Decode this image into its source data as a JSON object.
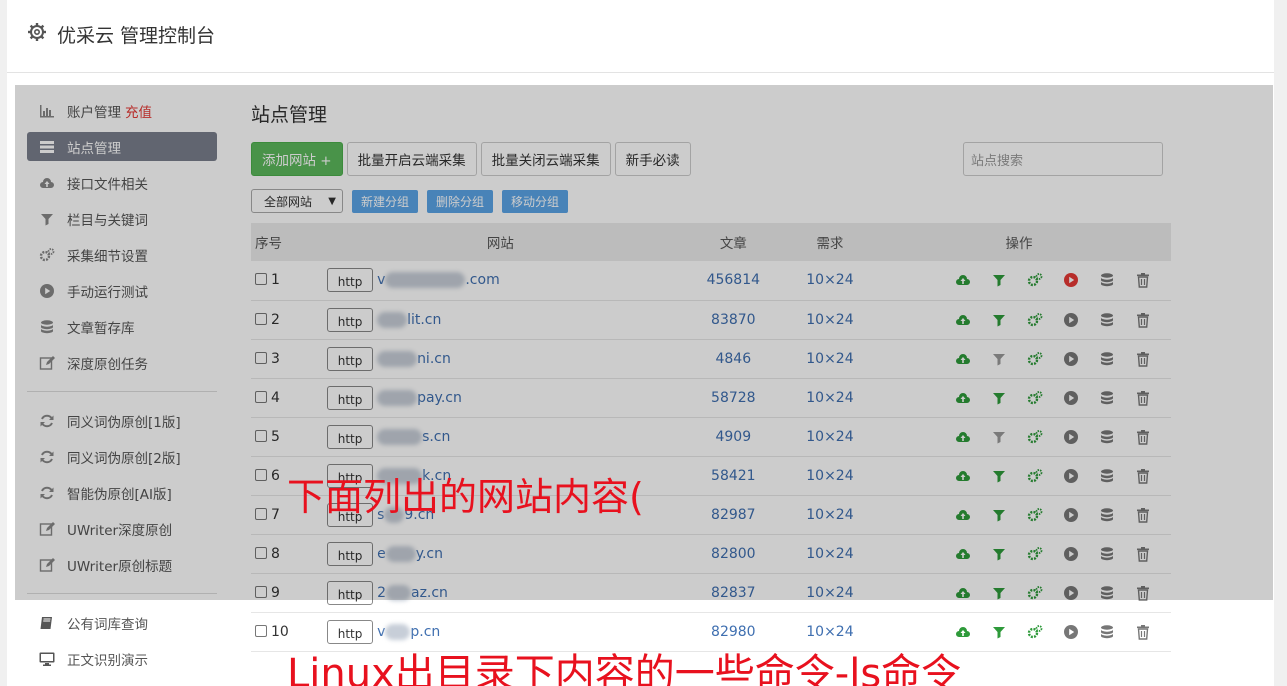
{
  "header": {
    "title": "优采云 管理控制台"
  },
  "sidebar": {
    "group1": [
      {
        "label": "账户管理",
        "icon": "bar-chart-icon",
        "extra": "充值"
      },
      {
        "label": "站点管理",
        "icon": "server-icon",
        "active": true
      },
      {
        "label": "接口文件相关",
        "icon": "cloud-upload-icon"
      },
      {
        "label": "栏目与关键词",
        "icon": "filter-icon"
      },
      {
        "label": "采集细节设置",
        "icon": "gears-icon"
      },
      {
        "label": "手动运行测试",
        "icon": "play-circle-icon"
      },
      {
        "label": "文章暂存库",
        "icon": "database-icon"
      },
      {
        "label": "深度原创任务",
        "icon": "edit-icon"
      }
    ],
    "group2": [
      {
        "label": "同义词伪原创[1版]",
        "icon": "refresh-icon"
      },
      {
        "label": "同义词伪原创[2版]",
        "icon": "refresh-icon"
      },
      {
        "label": "智能伪原创[AI版]",
        "icon": "refresh-icon"
      },
      {
        "label": "UWriter深度原创",
        "icon": "edit-icon"
      },
      {
        "label": "UWriter原创标题",
        "icon": "edit-icon"
      }
    ],
    "group3": [
      {
        "label": "公有词库查询",
        "icon": "book-icon"
      },
      {
        "label": "正文识别演示",
        "icon": "monitor-icon"
      }
    ]
  },
  "main": {
    "title": "站点管理",
    "buttons": {
      "add": "添加网站 +",
      "batch_on": "批量开启云端采集",
      "batch_off": "批量关闭云端采集",
      "guide": "新手必读"
    },
    "search_placeholder": "站点搜索",
    "filter_select": "全部网站",
    "group_buttons": [
      "新建分组",
      "删除分组",
      "移动分组"
    ],
    "table": {
      "headers": [
        "序号",
        "网站",
        "文章",
        "需求",
        "操作"
      ],
      "rows": [
        {
          "no": "1",
          "prefix": "v",
          "suffix": ".com",
          "blur": 80,
          "articles": "456814",
          "req": "10×24",
          "run_active": true
        },
        {
          "no": "2",
          "prefix": "",
          "suffix": "lit.cn",
          "blur": 30,
          "articles": "83870",
          "req": "10×24"
        },
        {
          "no": "3",
          "prefix": "",
          "suffix": "ni.cn",
          "blur": 40,
          "articles": "4846",
          "req": "10×24"
        },
        {
          "no": "4",
          "prefix": "",
          "suffix": "pay.cn",
          "blur": 40,
          "articles": "58728",
          "req": "10×24"
        },
        {
          "no": "5",
          "prefix": "",
          "suffix": "s.cn",
          "blur": 45,
          "articles": "4909",
          "req": "10×24"
        },
        {
          "no": "6",
          "prefix": "",
          "suffix": "k.cn",
          "blur": 45,
          "articles": "58421",
          "req": "10×24"
        },
        {
          "no": "7",
          "prefix": "s",
          "suffix": "9.cn",
          "blur": 20,
          "articles": "82987",
          "req": "10×24"
        },
        {
          "no": "8",
          "prefix": "e",
          "suffix": "y.cn",
          "blur": 30,
          "articles": "82800",
          "req": "10×24"
        },
        {
          "no": "9",
          "prefix": "2",
          "suffix": "az.cn",
          "blur": 25,
          "articles": "82837",
          "req": "10×24"
        },
        {
          "no": "10",
          "prefix": "v",
          "suffix": "p.cn",
          "blur": 25,
          "articles": "82980",
          "req": "10×24"
        }
      ]
    }
  },
  "annotations": {
    "caption1": "下面列出的网站内容(",
    "caption2": "Linux出目录下内容的一些命令-ls命令"
  },
  "colors": {
    "accent": "#5cb85c",
    "link": "#3f6fb0",
    "danger": "#e53935",
    "caption": "#e8111e"
  }
}
